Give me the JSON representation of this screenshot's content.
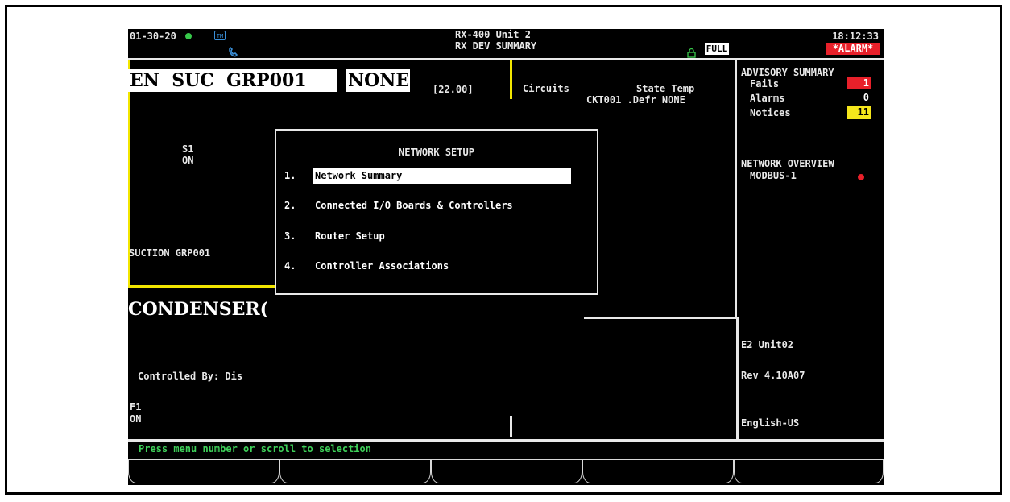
{
  "header": {
    "date": "01-30-20",
    "unit_name": "RX-400 Unit 2",
    "screen_name": "RX DEV SUMMARY",
    "view_mode": "FULL",
    "time": "18:12:33",
    "alarm": "*ALARM*",
    "status_icons": [
      "green-status-dot-icon",
      "phone-icon",
      "tm-icon",
      "lock-icon"
    ]
  },
  "main": {
    "group_title": "EN  SUC  GRP001",
    "group_state": "NONE",
    "group_value": "[22.00]",
    "circuits_header": "Circuits",
    "state_temp_header": "State Temp",
    "circuit_row": "CKT001 .Defr NONE",
    "s1_label": "S1",
    "s1_state": "ON",
    "suction_label": "SUCTION GRP001",
    "condenser_title": "CONDENSER(",
    "controlled_by": "Controlled By: Dis",
    "f1_label": "F1",
    "f1_state": "ON"
  },
  "sidebar": {
    "advisory_title": "ADVISORY SUMMARY",
    "fails_label": "Fails",
    "fails_count": "1",
    "alarms_label": "Alarms",
    "alarms_count": "0",
    "notices_label": "Notices",
    "notices_count": "11",
    "network_title": "NETWORK OVERVIEW",
    "network_item": "MODBUS-1",
    "unit_label": "E2 Unit02",
    "revision": "Rev 4.10A07",
    "language": "English-US"
  },
  "dialog": {
    "title": "NETWORK SETUP",
    "items": [
      {
        "num": "1.",
        "label": "Network Summary"
      },
      {
        "num": "2.",
        "label": "Connected I/O Boards & Controllers"
      },
      {
        "num": "3.",
        "label": "Router Setup"
      },
      {
        "num": "4.",
        "label": "Controller Associations"
      }
    ]
  },
  "status_bar": {
    "message": "Press menu number or scroll to selection"
  },
  "colors": {
    "background": "#000000",
    "text": "#e8e8e8",
    "accent_yellow": "#f2e600",
    "fails_red": "#e8202a",
    "notices_yellow": "#f5e61b",
    "alarm_red": "#e8202a",
    "status_green": "#37c84a",
    "status_text_green": "#3fd25a"
  }
}
